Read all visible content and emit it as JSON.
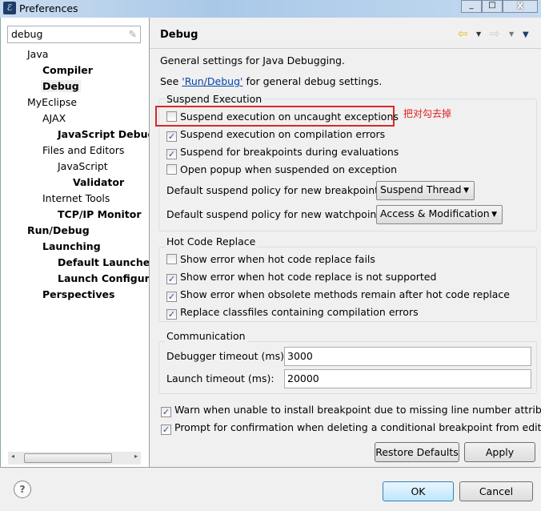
{
  "window": {
    "title": "Preferences",
    "controls": [
      "minimize",
      "maximize",
      "close"
    ]
  },
  "search": {
    "value": "debug"
  },
  "tree": [
    {
      "label": "Java",
      "level": 0,
      "bold": false
    },
    {
      "label": "Compiler",
      "level": 1,
      "bold": true
    },
    {
      "label": "Debug",
      "level": 1,
      "bold": true,
      "selected": true
    },
    {
      "label": "MyEclipse",
      "level": 0,
      "bold": false
    },
    {
      "label": "AJAX",
      "level": 1,
      "bold": false
    },
    {
      "label": "JavaScript Debug",
      "level": 2,
      "bold": true
    },
    {
      "label": "Files and Editors",
      "level": 1,
      "bold": false
    },
    {
      "label": "JavaScript",
      "level": 2,
      "bold": false
    },
    {
      "label": "Validator",
      "level": 3,
      "bold": true
    },
    {
      "label": "Internet Tools",
      "level": 1,
      "bold": false
    },
    {
      "label": "TCP/IP Monitor",
      "level": 2,
      "bold": true
    },
    {
      "label": "Run/Debug",
      "level": 0,
      "bold": true
    },
    {
      "label": "Launching",
      "level": 1,
      "bold": true
    },
    {
      "label": "Default Launchers",
      "level": 2,
      "bold": true
    },
    {
      "label": "Launch Configurations",
      "level": 2,
      "bold": true
    },
    {
      "label": "Perspectives",
      "level": 1,
      "bold": true
    }
  ],
  "page": {
    "title": "Debug",
    "description": "General settings for Java Debugging.",
    "see_prefix": "See ",
    "see_link": "'Run/Debug'",
    "see_suffix": " for general debug settings.",
    "suspend": {
      "label": "Suspend Execution",
      "items": [
        {
          "label": "Suspend execution on uncaught exceptions",
          "checked": false
        },
        {
          "label": "Suspend execution on compilation errors",
          "checked": true
        },
        {
          "label": "Suspend for breakpoints during evaluations",
          "checked": true
        },
        {
          "label": "Open popup when suspended on exception",
          "checked": false
        }
      ],
      "bp_policy_label": "Default suspend policy for new breakpoints:",
      "bp_policy_value": "Suspend Thread",
      "wp_policy_label": "Default suspend policy for new watchpoints:",
      "wp_policy_value": "Access & Modification"
    },
    "annotation": "把对勾去掉",
    "annotation_color": "#e02020",
    "hcr": {
      "label": "Hot Code Replace",
      "items": [
        {
          "label": "Show error when hot code replace fails",
          "checked": false
        },
        {
          "label": "Show error when hot code replace is not supported",
          "checked": true
        },
        {
          "label": "Show error when obsolete methods remain after hot code replace",
          "checked": true
        },
        {
          "label": "Replace classfiles containing compilation errors",
          "checked": true
        }
      ]
    },
    "comm": {
      "label": "Communication",
      "debugger_timeout_label": "Debugger timeout (ms):",
      "debugger_timeout_value": "3000",
      "launch_timeout_label": "Launch timeout (ms):",
      "launch_timeout_value": "20000"
    },
    "extra": [
      {
        "label": "Warn when unable to install breakpoint due to missing line number attributes",
        "checked": true
      },
      {
        "label": "Prompt for confirmation when deleting a conditional breakpoint from editor",
        "checked": true
      }
    ],
    "restore_label": "Restore Defaults",
    "apply_label": "Apply"
  },
  "footer": {
    "ok_label": "OK",
    "cancel_label": "Cancel"
  }
}
